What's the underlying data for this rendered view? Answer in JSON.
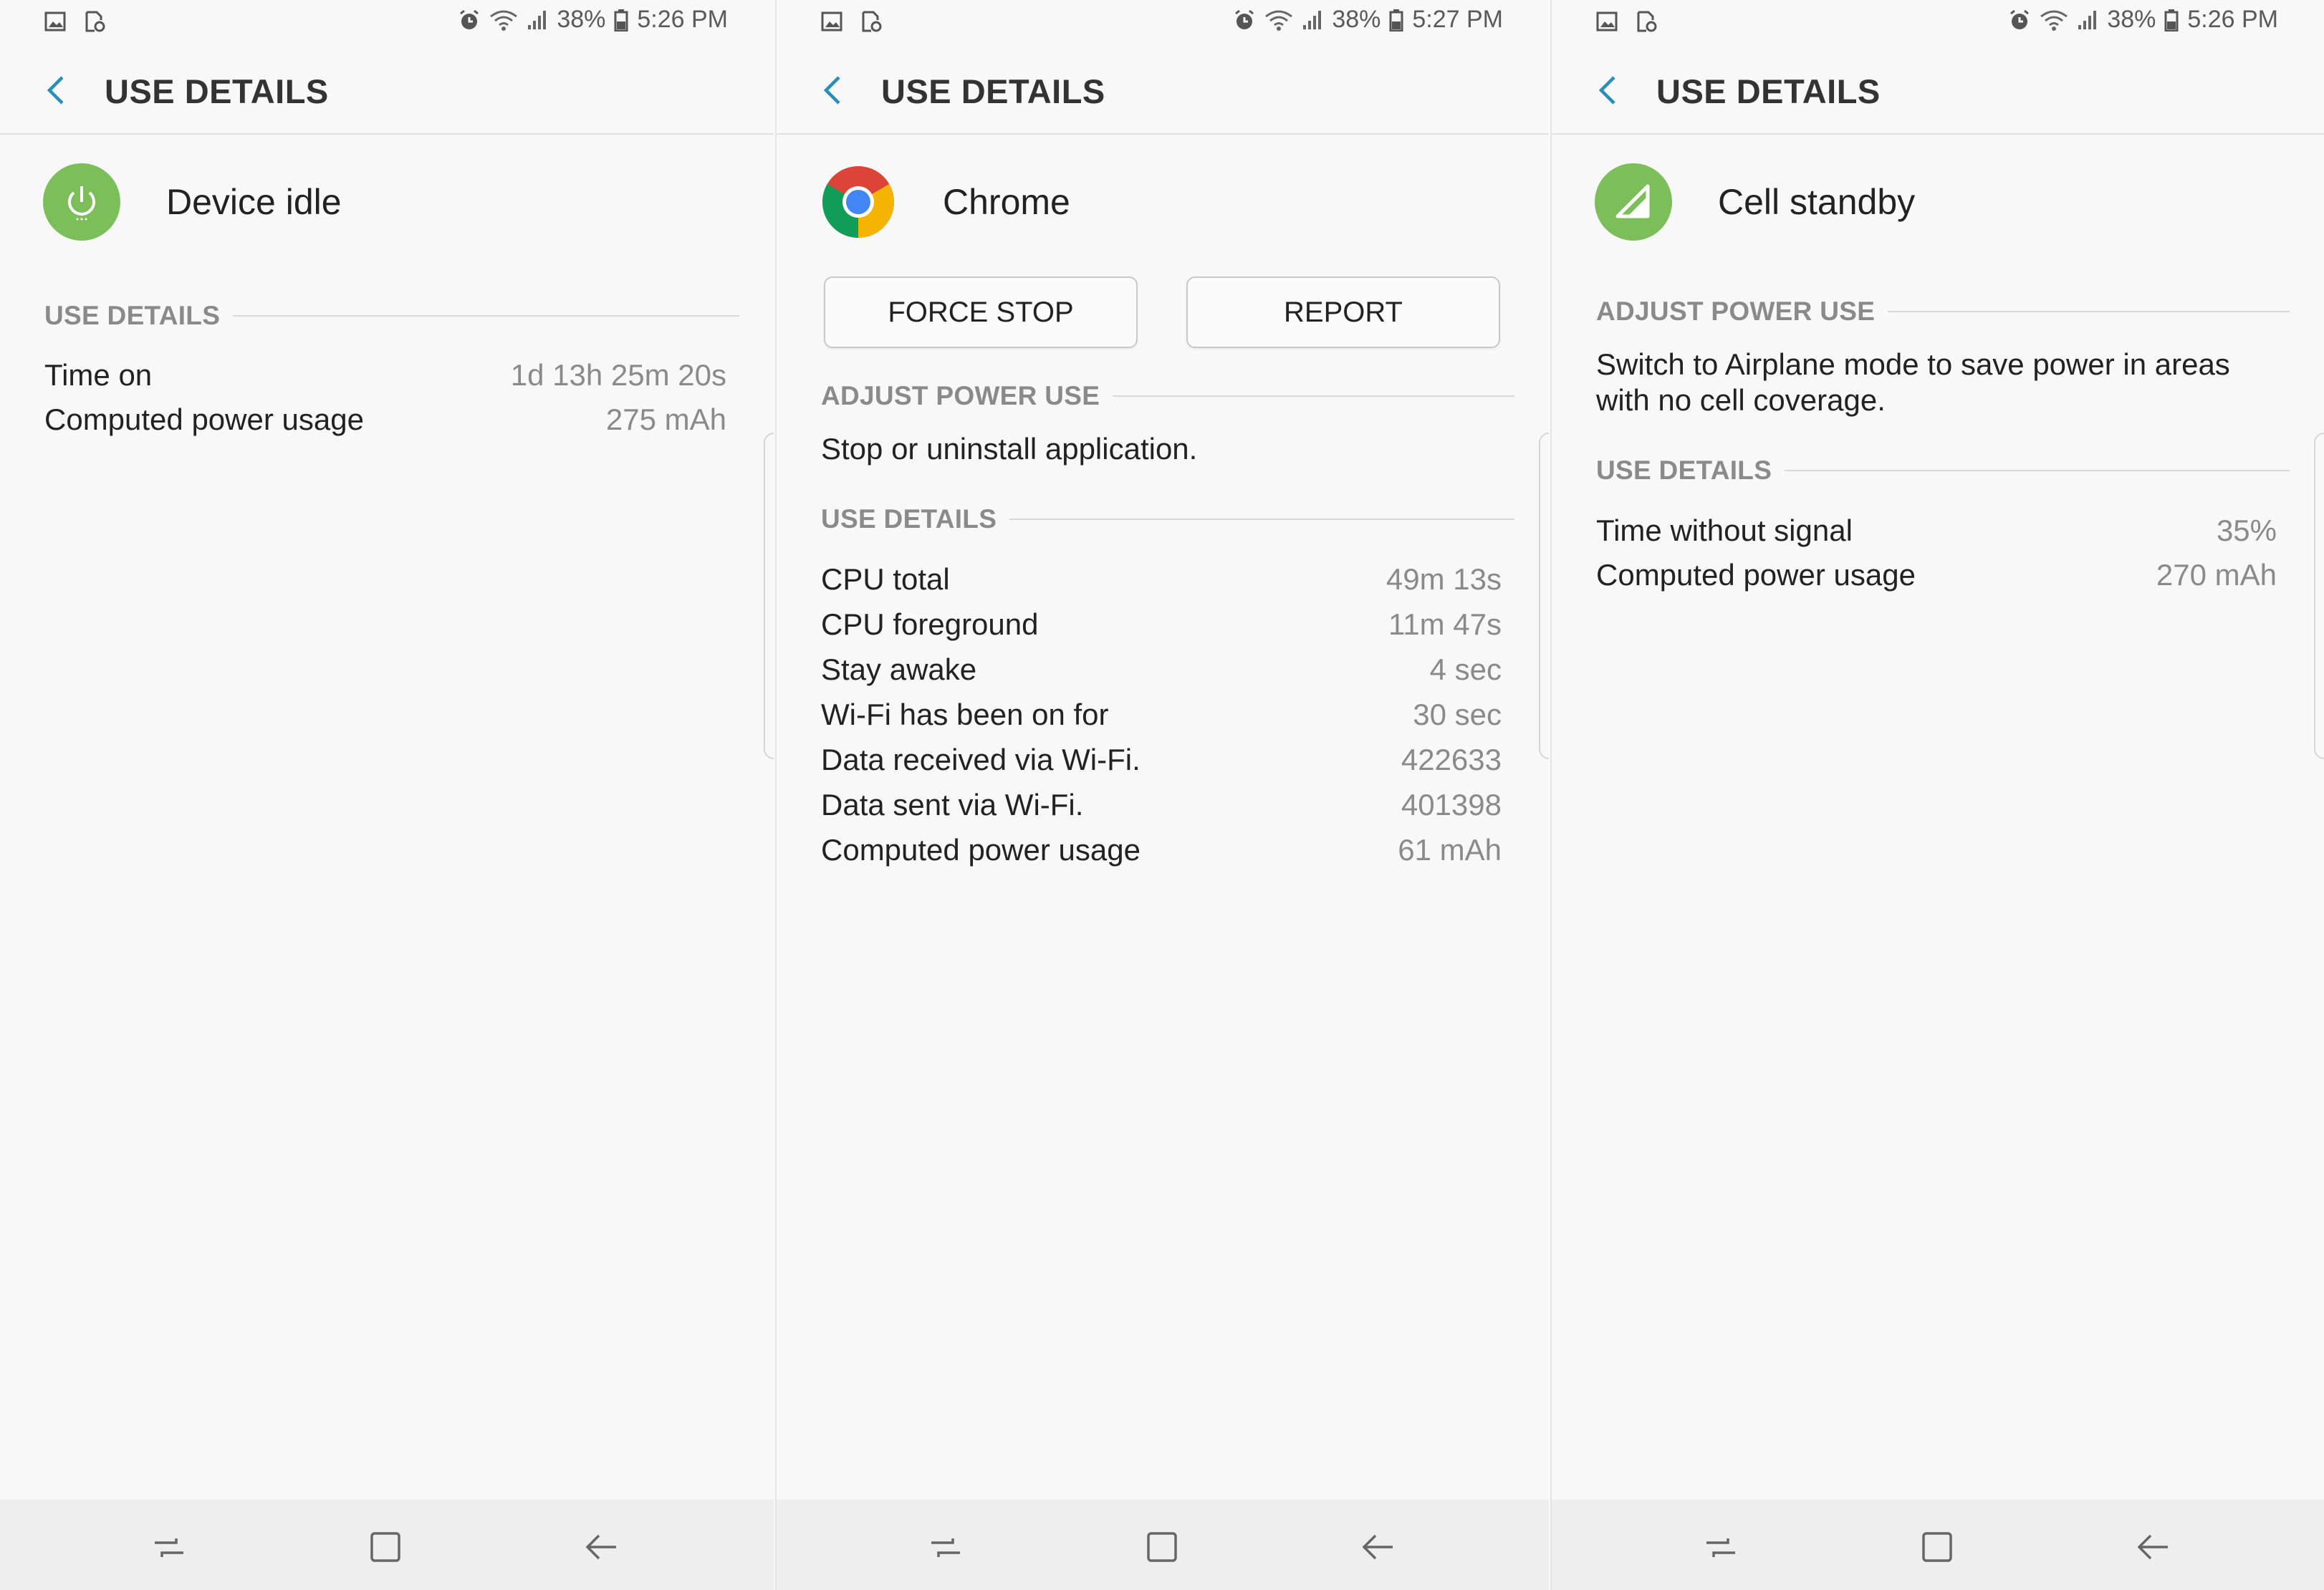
{
  "colors": {
    "accent_blue": "#2a8fb8",
    "icon_green": "#7cbf5a",
    "muted_text": "#8a8a8a"
  },
  "status_bar": {
    "battery": "38%"
  },
  "nav_icons": [
    "recent-apps-icon",
    "home-icon",
    "back-arrow-icon"
  ],
  "panels": [
    {
      "status_time": "5:26 PM",
      "title": "USE DETAILS",
      "entity": {
        "name": "Device idle",
        "icon": "power-icon"
      },
      "use_details": {
        "header": "USE DETAILS",
        "rows": [
          {
            "label": "Time on",
            "value": "1d 13h 25m 20s"
          },
          {
            "label": "Computed power usage",
            "value": "275 mAh"
          }
        ]
      }
    },
    {
      "status_time": "5:27 PM",
      "title": "USE DETAILS",
      "entity": {
        "name": "Chrome",
        "icon": "chrome-icon"
      },
      "buttons": {
        "force_stop": "FORCE STOP",
        "report": "REPORT"
      },
      "adjust": {
        "header": "ADJUST POWER USE",
        "text": "Stop or uninstall application."
      },
      "use_details": {
        "header": "USE DETAILS",
        "rows": [
          {
            "label": "CPU total",
            "value": "49m 13s"
          },
          {
            "label": "CPU foreground",
            "value": "11m 47s"
          },
          {
            "label": "Stay awake",
            "value": "4 sec"
          },
          {
            "label": "Wi-Fi has been on for",
            "value": "30 sec"
          },
          {
            "label": "Data received via Wi-Fi.",
            "value": "422633"
          },
          {
            "label": "Data sent via Wi-Fi.",
            "value": "401398"
          },
          {
            "label": "Computed power usage",
            "value": "61 mAh"
          }
        ]
      }
    },
    {
      "status_time": "5:26 PM",
      "title": "USE DETAILS",
      "entity": {
        "name": "Cell standby",
        "icon": "cell-signal-icon"
      },
      "adjust": {
        "header": "ADJUST POWER USE",
        "text_line1": "Switch to Airplane mode to save power in areas",
        "text_line2": "with no cell coverage."
      },
      "use_details": {
        "header": "USE DETAILS",
        "rows": [
          {
            "label": "Time without signal",
            "value": "35%"
          },
          {
            "label": "Computed power usage",
            "value": "270 mAh"
          }
        ]
      }
    }
  ]
}
